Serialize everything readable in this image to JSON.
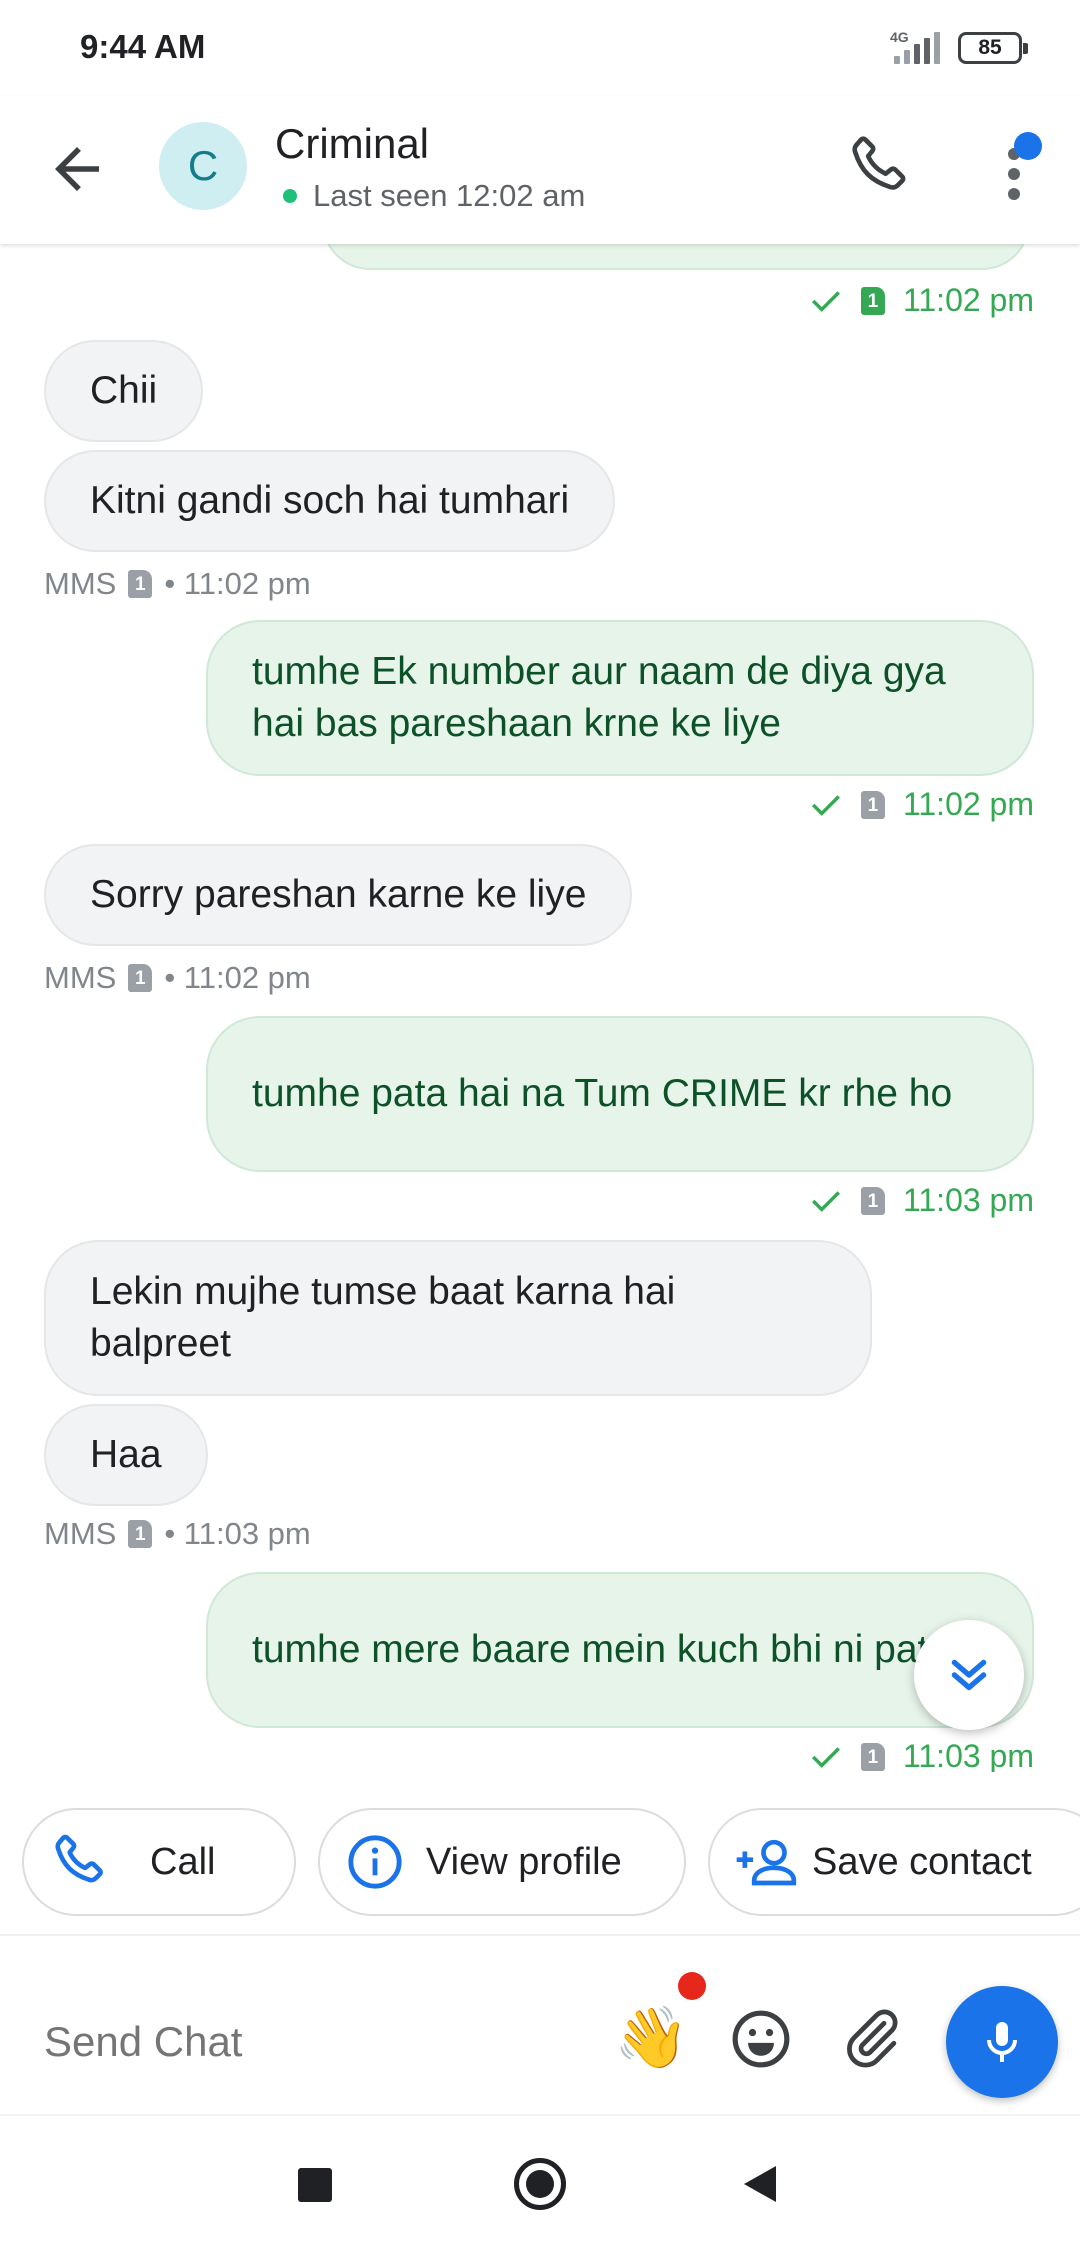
{
  "status_bar": {
    "time": "9:44 AM",
    "network_type": "4G",
    "battery": "85",
    "icons": [
      "signal-icon",
      "battery-icon"
    ]
  },
  "header": {
    "avatar_letter": "C",
    "contact_name": "Criminal",
    "last_seen": "Last seen 12:02 am",
    "icons": [
      "back-arrow-icon",
      "phone-icon",
      "more-vert-icon"
    ],
    "colors": {
      "avatar_bg": "#cfeef2",
      "avatar_text": "#137d8a",
      "online": "#1ec07a",
      "accent": "#1a73e8"
    }
  },
  "messages": [
    {
      "direction": "out",
      "text": "",
      "partial": true
    },
    {
      "direction": "meta-out",
      "sim": "1",
      "time": "11:02 pm",
      "sim_color": "green"
    },
    {
      "direction": "in",
      "text": "Chii"
    },
    {
      "direction": "in",
      "text": "Kitni gandi soch hai tumhari"
    },
    {
      "direction": "meta-in",
      "label": "MMS",
      "sim": "1",
      "time": "• 11:02 pm"
    },
    {
      "direction": "out",
      "text": "tumhe Ek number aur naam de diya gya hai bas pareshaan krne ke liye"
    },
    {
      "direction": "meta-out",
      "sim": "1",
      "time": "11:02 pm"
    },
    {
      "direction": "in",
      "text": "Sorry pareshan karne ke liye"
    },
    {
      "direction": "meta-in",
      "label": "MMS",
      "sim": "1",
      "time": "• 11:02 pm"
    },
    {
      "direction": "out",
      "text": "tumhe pata hai na Tum CRIME kr rhe ho"
    },
    {
      "direction": "meta-out",
      "sim": "1",
      "time": "11:03 pm"
    },
    {
      "direction": "in",
      "text": "Lekin mujhe tumse baat karna hai balpreet"
    },
    {
      "direction": "in",
      "text": "Haa"
    },
    {
      "direction": "meta-in",
      "label": "MMS",
      "sim": "1",
      "time": "• 11:03 pm"
    },
    {
      "direction": "out",
      "text": "tumhe mere baare mein kuch bhi ni pata"
    },
    {
      "direction": "meta-out",
      "sim": "1",
      "time": "11:03 pm"
    }
  ],
  "message_colors": {
    "incoming_bg": "#f1f3f4",
    "outgoing_bg": "#e6f4ea",
    "outgoing_text": "#0d5128",
    "meta_green": "#34a853"
  },
  "chips": [
    {
      "label": "Call",
      "icon": "phone-icon"
    },
    {
      "label": "View profile",
      "icon": "info-icon"
    },
    {
      "label": "Save contact",
      "icon": "add-person-icon"
    }
  ],
  "composer": {
    "placeholder": "Send Chat",
    "wave_emoji": "👋",
    "icons": [
      "wave-emoji-icon",
      "emoji-icon",
      "attach-icon",
      "mic-icon"
    ]
  },
  "nav_bar": {
    "icons": [
      "recents-square-icon",
      "home-circle-icon",
      "back-triangle-icon"
    ]
  }
}
